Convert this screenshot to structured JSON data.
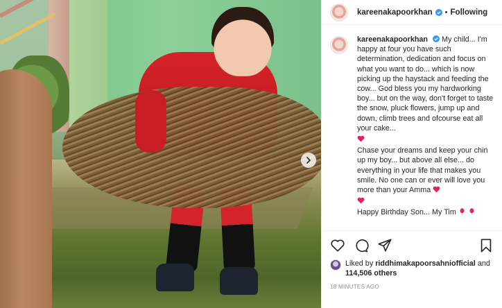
{
  "header": {
    "username": "kareenakapoorkhan",
    "separator": "•",
    "follow_label": "Following"
  },
  "caption": {
    "username": "kareenakapoorkhan",
    "para1": "My child... I'm happy at four you have such determination, dedication and focus on what you want to do... which is now picking up the haystack and feeding the cow... God bless you my hardworking boy... but on the way, don't forget to taste the snow, pluck flowers, jump up and down, climb trees and ofcourse eat all your cake...",
    "para2": "Chase your dreams and keep your chin up my boy... but above all else... do everything in your life that makes you smile. No one can or ever will love you more than your Amma",
    "para3": "Happy Birthday Son... My Tim"
  },
  "actions": {
    "icons": [
      "heart-icon",
      "comment-icon",
      "share-icon",
      "bookmark-icon"
    ]
  },
  "likes": {
    "prefix": "Liked by",
    "user": "riddhimakapoorsahniofficial",
    "and": "and",
    "count": "114,506 others"
  },
  "timestamp": "18 MINUTES AGO",
  "colors": {
    "text": "#262626",
    "muted": "#8e8e8e",
    "verified": "#3897f0",
    "heart_red": "#e0245e"
  }
}
